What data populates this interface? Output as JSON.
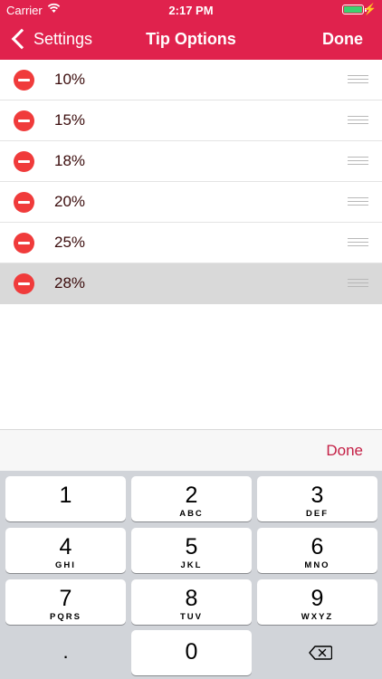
{
  "status_bar": {
    "carrier": "Carrier",
    "time": "2:17 PM"
  },
  "nav": {
    "back_label": "Settings",
    "title": "Tip Options",
    "done_label": "Done"
  },
  "tips": [
    {
      "label": "10%"
    },
    {
      "label": "15%"
    },
    {
      "label": "18%"
    },
    {
      "label": "20%"
    },
    {
      "label": "25%"
    },
    {
      "label": "28%"
    }
  ],
  "accessory": {
    "done_label": "Done"
  },
  "keypad": [
    {
      "num": "1",
      "letters": ""
    },
    {
      "num": "2",
      "letters": "ABC"
    },
    {
      "num": "3",
      "letters": "DEF"
    },
    {
      "num": "4",
      "letters": "GHI"
    },
    {
      "num": "5",
      "letters": "JKL"
    },
    {
      "num": "6",
      "letters": "MNO"
    },
    {
      "num": "7",
      "letters": "PQRS"
    },
    {
      "num": "8",
      "letters": "TUV"
    },
    {
      "num": "9",
      "letters": "WXYZ"
    }
  ],
  "keypad_bottom": {
    "decimal": ".",
    "zero": "0"
  },
  "colors": {
    "accent": "#e0224d",
    "delete": "#f03b3b",
    "done_text": "#c41f45"
  },
  "icons": {
    "back": "chevron-left-icon",
    "delete": "minus-circle-icon",
    "reorder": "reorder-grip-icon",
    "backspace": "backspace-icon",
    "wifi": "wifi-icon",
    "battery": "battery-icon",
    "charging": "charging-bolt-icon"
  }
}
